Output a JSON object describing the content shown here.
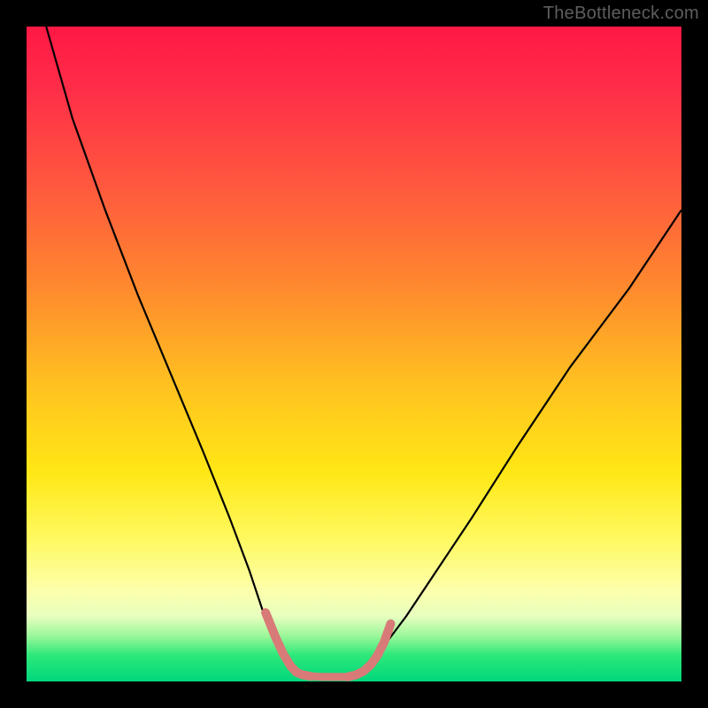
{
  "watermark": "TheBottleneck.com",
  "chart_data": {
    "type": "line",
    "title": "",
    "xlabel": "",
    "ylabel": "",
    "xlim": [
      0,
      100
    ],
    "ylim": [
      0,
      100
    ],
    "grid": false,
    "legend": false,
    "annotations": [],
    "series": [
      {
        "name": "main-curve",
        "stroke": "#000000",
        "stroke_width": 2.2,
        "x": [
          3,
          7,
          12,
          17,
          22,
          27,
          31,
          34,
          36,
          38,
          39.5,
          41,
          45,
          49,
          51,
          53,
          55,
          58,
          62,
          68,
          75,
          83,
          92,
          100
        ],
        "y": [
          100,
          86,
          72,
          59,
          47,
          35,
          25,
          17,
          11,
          6,
          3,
          1.5,
          0.7,
          0.7,
          1.5,
          3,
          6,
          10,
          16,
          25,
          36,
          48,
          60,
          72
        ]
      },
      {
        "name": "marker-band-left",
        "stroke": "#d87a78",
        "stroke_width": 10,
        "linecap": "round",
        "x": [
          36.5,
          38,
          39.2,
          40.3,
          41.2,
          42.2,
          43.3
        ],
        "y": [
          10.5,
          6.8,
          4.2,
          2.4,
          1.4,
          1.0,
          0.8
        ]
      },
      {
        "name": "marker-band-bottom",
        "stroke": "#d87a78",
        "stroke_width": 9,
        "linecap": "round",
        "x": [
          43.3,
          45.0,
          47.0,
          49.0
        ],
        "y": [
          0.8,
          0.7,
          0.7,
          0.7
        ]
      },
      {
        "name": "marker-band-right",
        "stroke": "#d87a78",
        "stroke_width": 10,
        "linecap": "round",
        "x": [
          49.0,
          50.3,
          51.5,
          52.6,
          53.6,
          54.6,
          55.6
        ],
        "y": [
          0.7,
          1.0,
          1.6,
          2.6,
          4.0,
          6.0,
          8.8
        ]
      }
    ],
    "colors": {
      "gradient_stops": [
        {
          "pos": 0,
          "hex": "#ff1845"
        },
        {
          "pos": 10,
          "hex": "#ff2f48"
        },
        {
          "pos": 25,
          "hex": "#ff5a3d"
        },
        {
          "pos": 40,
          "hex": "#ff8a2e"
        },
        {
          "pos": 55,
          "hex": "#ffc220"
        },
        {
          "pos": 68,
          "hex": "#ffe715"
        },
        {
          "pos": 78,
          "hex": "#fff95e"
        },
        {
          "pos": 86,
          "hex": "#fdffaa"
        },
        {
          "pos": 90,
          "hex": "#e7ffbf"
        },
        {
          "pos": 93,
          "hex": "#9df79a"
        },
        {
          "pos": 96,
          "hex": "#2de87a"
        },
        {
          "pos": 100,
          "hex": "#00d77c"
        }
      ]
    }
  }
}
